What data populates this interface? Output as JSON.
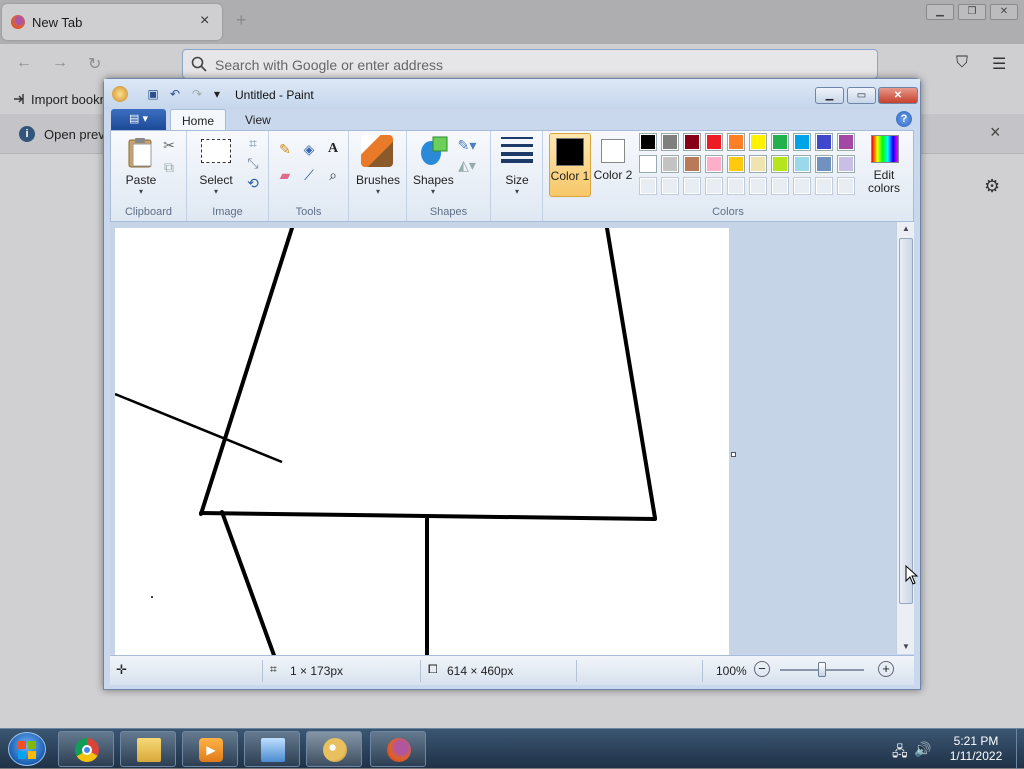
{
  "firefox": {
    "tab_title": "New Tab",
    "tab_close": "×",
    "new_tab": "+",
    "url_placeholder": "Search with Google or enter address",
    "bookmark_import": "Import bookm",
    "notification_text": "Open previ",
    "notification_close": "×"
  },
  "paint": {
    "title": "Untitled - Paint",
    "tabs": [
      "Home",
      "View"
    ],
    "groups": {
      "clipboard": {
        "label": "Clipboard",
        "paste": "Paste"
      },
      "image": {
        "label": "Image",
        "select": "Select"
      },
      "tools": {
        "label": "Tools"
      },
      "brushes": {
        "label": "Brushes"
      },
      "shapes": {
        "label": "Shapes",
        "shapes": "Shapes"
      },
      "size": {
        "label": "Size"
      },
      "colors": {
        "label": "Colors",
        "color1": "Color 1",
        "color2": "Color 2",
        "edit_colors": "Edit colors",
        "color1_value": "#000000",
        "color2_value": "#ffffff",
        "palette_row1": [
          "#000000",
          "#7f7f7f",
          "#880015",
          "#ed1c24",
          "#ff7f27",
          "#fff200",
          "#22b14c",
          "#00a2e8",
          "#3f48cc",
          "#a349a4"
        ],
        "palette_row2": [
          "#ffffff",
          "#c3c3c3",
          "#b97a57",
          "#ffaec9",
          "#ffc90e",
          "#efe4b0",
          "#b5e61d",
          "#99d9ea",
          "#7092be",
          "#c8bfe7"
        ]
      }
    },
    "status": {
      "cursor_pos": "1 × 173px",
      "canvas_size": "614 × 460px",
      "zoom": "100%"
    }
  },
  "taskbar": {
    "time": "5:21 PM",
    "date": "1/11/2022",
    "apps": [
      "chrome-icon",
      "explorer-icon",
      "media-player-icon",
      "control-panel-icon",
      "paint-icon",
      "firefox-icon"
    ]
  }
}
